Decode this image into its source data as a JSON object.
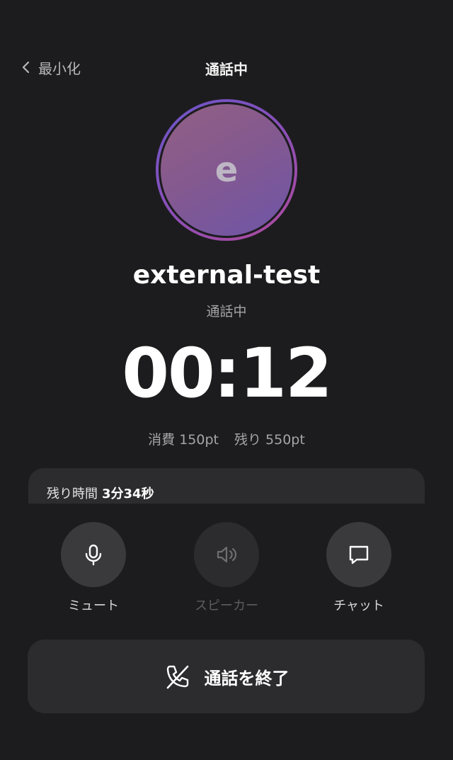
{
  "header": {
    "back_label": "最小化",
    "title": "通話中"
  },
  "avatar": {
    "initial": "e"
  },
  "caller": {
    "name": "external-test",
    "status": "通話中"
  },
  "timer": "00:12",
  "points": {
    "consumed": "消費 150pt",
    "remaining": "残り 550pt"
  },
  "remaining_time": {
    "label": "残り時間",
    "value": "3分34秒"
  },
  "controls": {
    "mute": {
      "label": "ミュート",
      "icon": "microphone-icon"
    },
    "speaker": {
      "label": "スピーカー",
      "icon": "speaker-icon"
    },
    "chat": {
      "label": "チャット",
      "icon": "chat-bubble-icon"
    }
  },
  "end_call": {
    "label": "通話を終了",
    "icon": "phone-end-icon"
  },
  "colors": {
    "background": "#1c1c1e",
    "card": "#2c2c2e",
    "control_bg": "#3a3a3c",
    "avatar_ring_start": "#6a55c8",
    "avatar_ring_end": "#b04a9a"
  }
}
